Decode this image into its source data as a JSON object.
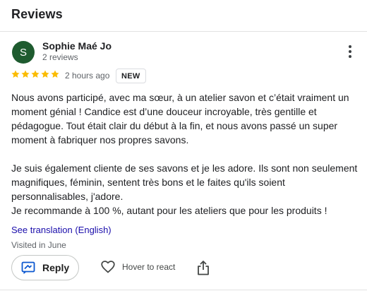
{
  "section": {
    "title": "Reviews"
  },
  "review": {
    "avatar_letter": "S",
    "avatar_color": "#1e5b2f",
    "author": "Sophie Maé Jo",
    "author_reviews": "2 reviews",
    "rating": 5,
    "rating_max": 5,
    "star_color": "#fbbc04",
    "time": "2 hours ago",
    "badge": "NEW",
    "paragraphs": [
      "Nous avons participé, avec ma sœur, à un atelier savon et c’était vraiment un moment génial ! Candice est d’une douceur incroyable, très gentille et pédagogue. Tout était clair du début à la fin, et nous avons passé un super moment à fabriquer nos propres savons.",
      "Je suis également cliente de ses savons et je les adore. Ils sont non seulement magnifiques, féminin, sentent très bons et le faites qu'ils soient personnalisables, j'adore.",
      "Je recommande à 100 %, autant pour les ateliers que pour les produits !"
    ],
    "translation_link": "See translation (English)",
    "visited": "Visited in June"
  },
  "actions": {
    "reply_label": "Reply",
    "react_label": "Hover to react",
    "icons": [
      "more-vert-icon",
      "reply-icon",
      "heart-icon",
      "share-icon",
      "star-icon"
    ]
  }
}
